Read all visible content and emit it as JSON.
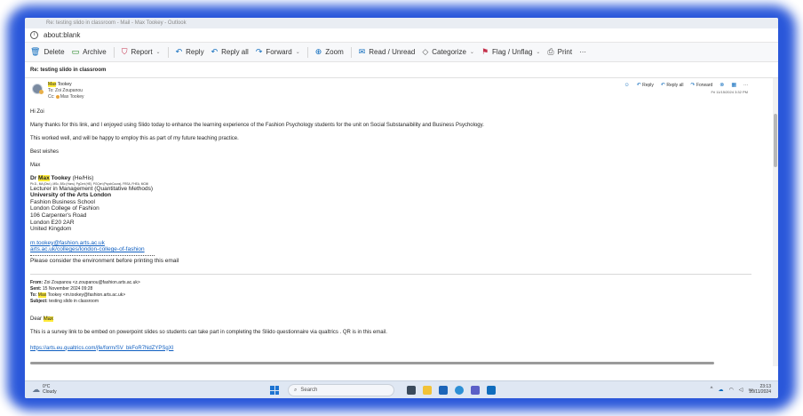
{
  "window": {
    "title": "Re: testing slido in classroom - Mail - Max Tookey - Outlook",
    "address": "about:blank"
  },
  "toolbar": {
    "delete": "Delete",
    "archive": "Archive",
    "report": "Report",
    "reply": "Reply",
    "reply_all": "Reply all",
    "forward": "Forward",
    "zoom": "Zoom",
    "read_unread": "Read / Unread",
    "categorize": "Categorize",
    "flag": "Flag / Unflag",
    "print": "Print",
    "more": "···"
  },
  "subject": "Re: testing slido in classroom",
  "message": {
    "from_first": "Max",
    "from_last": "Tookey",
    "to": "To: Zoi Zoupanou",
    "cc_label": "Cc:",
    "cc_first": "Max",
    "cc_last": "Tookey",
    "date": "Fri 11/15/2024 3:32 PM",
    "actions": {
      "reply": "Reply",
      "reply_all": "Reply all",
      "forward": "Forward"
    },
    "greeting": "Hi Zoi",
    "p1": "Many thanks for this link, and I enjoyed using Slido today to enhance the learning experience of the Fashion Psychology students for the unit on Social Substanaibility and Business Psychology.",
    "p2": "This worked well, and will be happy to employ this as part of my future teaching practice.",
    "closing": "Best wishes",
    "name": "Max"
  },
  "signature": {
    "title": "Dr",
    "first": "Max",
    "last": "Tookey",
    "pronouns": "(He/His)",
    "quals": "Ph.D., MA (Dist.), MSc, BSc (Hons), PgCert (HE), PGCert (PsychCouns), FRSA, FHEA, MCMI",
    "role": "Lecturer in Management (Quantitative Methods)",
    "uni": "University of the Arts London",
    "school": "Fashion Business School",
    "college": "London College of Fashion",
    "address1": "106 Carpenter's Road",
    "address2": "London E20 2AR",
    "country": "United Kingdom",
    "email": "m.tookey@fashion.arts.ac.uk",
    "web": "arts.ac.uk/colleges/london-college-of-fashion",
    "env": "Please consider the environment before printing this email"
  },
  "original": {
    "from_label": "From:",
    "from": "Zoi Zoupanou <z.zoupanou@fashion.arts.ac.uk>",
    "sent_label": "Sent:",
    "sent": "15 November 2024 09:28",
    "to_label": "To:",
    "to_first": "Max",
    "to_rest": "Tookey <m.tookey@fashion.arts.ac.uk>",
    "subject_label": "Subject:",
    "subject": "testing slido in classroom",
    "dear": "Dear",
    "dear_name": "Max",
    "body": "This is a survey link to be embed on powerpoint slides so students can take part in completing the Sliido questionnaire via qualtrics . QR is in this email.",
    "link": "https://arts.eu.qualtrics.com/jfe/form/SV_bkFoR7NdZYPSgXI"
  },
  "taskbar": {
    "temp": "0°C",
    "weather": "Cloudy",
    "search": "Search",
    "time": "23:13",
    "date": "20/11/2024"
  }
}
